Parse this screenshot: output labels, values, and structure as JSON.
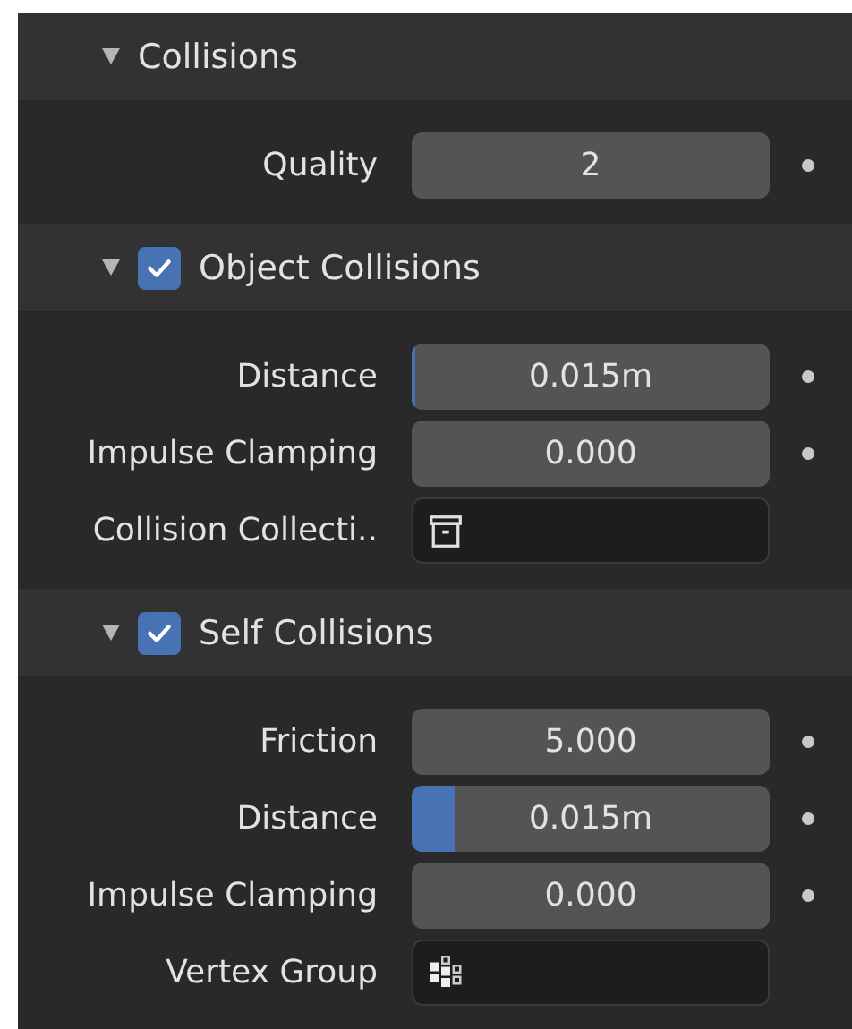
{
  "panels": [
    {
      "title": "Collisions",
      "expanded": true,
      "rows": [
        {
          "kind": "number",
          "label": "Quality",
          "value": "2"
        }
      ]
    },
    {
      "title": "Object Collisions",
      "expanded": true,
      "checked": true,
      "rows": [
        {
          "kind": "slider",
          "label": "Distance",
          "value": "0.015m",
          "level": 0.01
        },
        {
          "kind": "number",
          "label": "Impulse Clamping",
          "value": "0.000"
        },
        {
          "kind": "collection",
          "label": "Collision Collecti.."
        }
      ]
    },
    {
      "title": "Self Collisions",
      "expanded": true,
      "checked": true,
      "rows": [
        {
          "kind": "number",
          "label": "Friction",
          "value": "5.000"
        },
        {
          "kind": "slider",
          "label": "Distance",
          "value": "0.015m",
          "level": 0.12
        },
        {
          "kind": "number",
          "label": "Impulse Clamping",
          "value": "0.000"
        },
        {
          "kind": "vertexgroup",
          "label": "Vertex Group"
        }
      ]
    }
  ]
}
